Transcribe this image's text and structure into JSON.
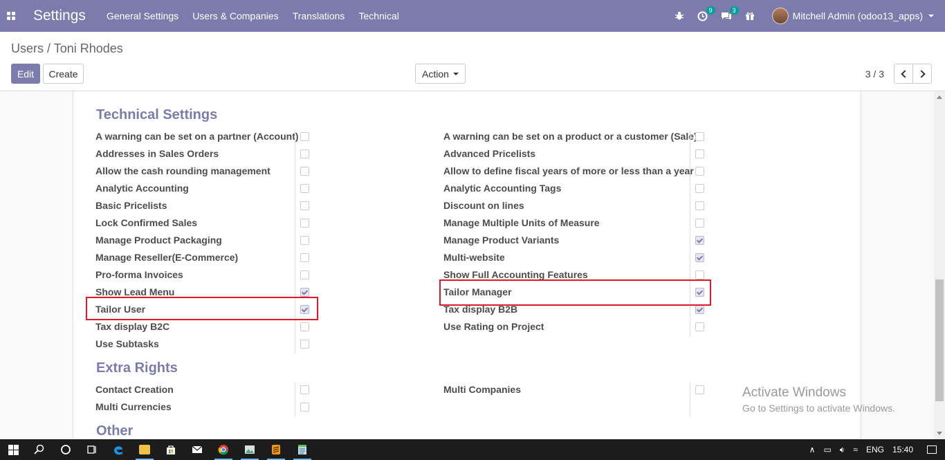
{
  "navbar": {
    "brand": "Settings",
    "menu": [
      "General Settings",
      "Users & Companies",
      "Translations",
      "Technical"
    ],
    "activity_badge": "9",
    "messages_badge": "3",
    "user_name": "Mitchell Admin (odoo13_apps)"
  },
  "breadcrumb": {
    "parent": "Users",
    "separator": "/",
    "current": "Toni Rhodes"
  },
  "buttons": {
    "edit": "Edit",
    "create": "Create",
    "action": "Action"
  },
  "pager": {
    "value": "3 / 3"
  },
  "sections": {
    "technical": "Technical Settings",
    "extra": "Extra Rights",
    "other": "Other"
  },
  "technical_left": [
    {
      "label": "A warning can be set on a partner (Account)",
      "checked": false
    },
    {
      "label": "Addresses in Sales Orders",
      "checked": false
    },
    {
      "label": "Allow the cash rounding management",
      "checked": false
    },
    {
      "label": "Analytic Accounting",
      "checked": false
    },
    {
      "label": "Basic Pricelists",
      "checked": false
    },
    {
      "label": "Lock Confirmed Sales",
      "checked": false
    },
    {
      "label": "Manage Product Packaging",
      "checked": false
    },
    {
      "label": "Manage Reseller(E-Commerce)",
      "checked": false
    },
    {
      "label": "Pro-forma Invoices",
      "checked": false
    },
    {
      "label": "Show Lead Menu",
      "checked": true
    },
    {
      "label": "Tailor User",
      "checked": true
    },
    {
      "label": "Tax display B2C",
      "checked": false
    },
    {
      "label": "Use Subtasks",
      "checked": false
    }
  ],
  "technical_right": [
    {
      "label": "A warning can be set on a product or a customer (Sale)",
      "checked": false
    },
    {
      "label": "Advanced Pricelists",
      "checked": false
    },
    {
      "label": "Allow to define fiscal years of more or less than a year",
      "checked": false
    },
    {
      "label": "Analytic Accounting Tags",
      "checked": false
    },
    {
      "label": "Discount on lines",
      "checked": false
    },
    {
      "label": "Manage Multiple Units of Measure",
      "checked": false
    },
    {
      "label": "Manage Product Variants",
      "checked": true
    },
    {
      "label": "Multi-website",
      "checked": true
    },
    {
      "label": "Show Full Accounting Features",
      "checked": false
    },
    {
      "label": "Tailor Manager",
      "checked": true
    },
    {
      "label": "Tax display B2B",
      "checked": true
    },
    {
      "label": "Use Rating on Project",
      "checked": false
    }
  ],
  "extra_left": [
    {
      "label": "Contact Creation",
      "checked": false
    },
    {
      "label": "Multi Currencies",
      "checked": false
    }
  ],
  "extra_right": [
    {
      "label": "Multi Companies",
      "checked": false
    }
  ],
  "watermark": {
    "title": "Activate Windows",
    "subtitle": "Go to Settings to activate Windows."
  },
  "taskbar": {
    "language": "ENG",
    "time": "15:40",
    "apps": [
      "start-icon",
      "search-icon",
      "cortana-icon",
      "task-view-icon",
      "edge-icon",
      "file-explorer-icon",
      "store-icon",
      "mail-icon",
      "chrome-icon",
      "photos-icon",
      "sublime-text-icon",
      "notepad-icon"
    ]
  }
}
